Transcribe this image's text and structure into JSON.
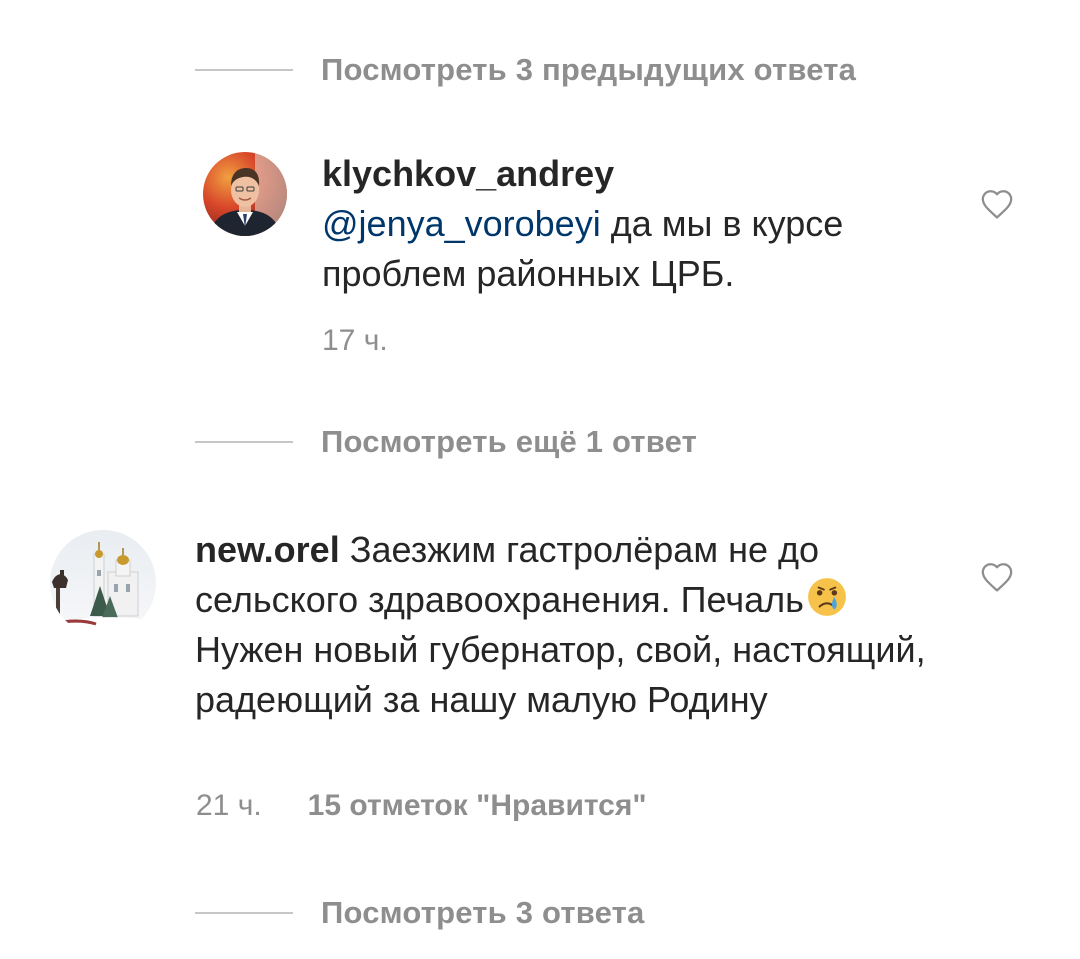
{
  "thread": {
    "view_previous_label": "Посмотреть 3 предыдущих ответа",
    "reply": {
      "username": "klychkov_andrey",
      "mention": "@jenya_vorobeyi",
      "text": " да мы в курсе проблем районных ЦРБ.",
      "time": "17 ч."
    },
    "view_more_label": "Посмотреть ещё 1 ответ"
  },
  "comment": {
    "username": "new.orel",
    "text_part1": " Заезжим гастролёрам не до сельского здравоохранения. Печаль",
    "emoji": "crying-face-emoji",
    "text_part2": " Нужен новый губернатор, свой, настоящий, радеющий за нашу малую Родину",
    "time": "21 ч.",
    "likes": "15 отметок \"Нравится\"",
    "view_replies_label": "Посмотреть 3 ответа"
  },
  "icons": {
    "like": "heart-outline-icon"
  },
  "colors": {
    "text": "#262626",
    "muted": "#8e8e8e",
    "mention": "#00376b",
    "divider": "#c7c7c7"
  }
}
